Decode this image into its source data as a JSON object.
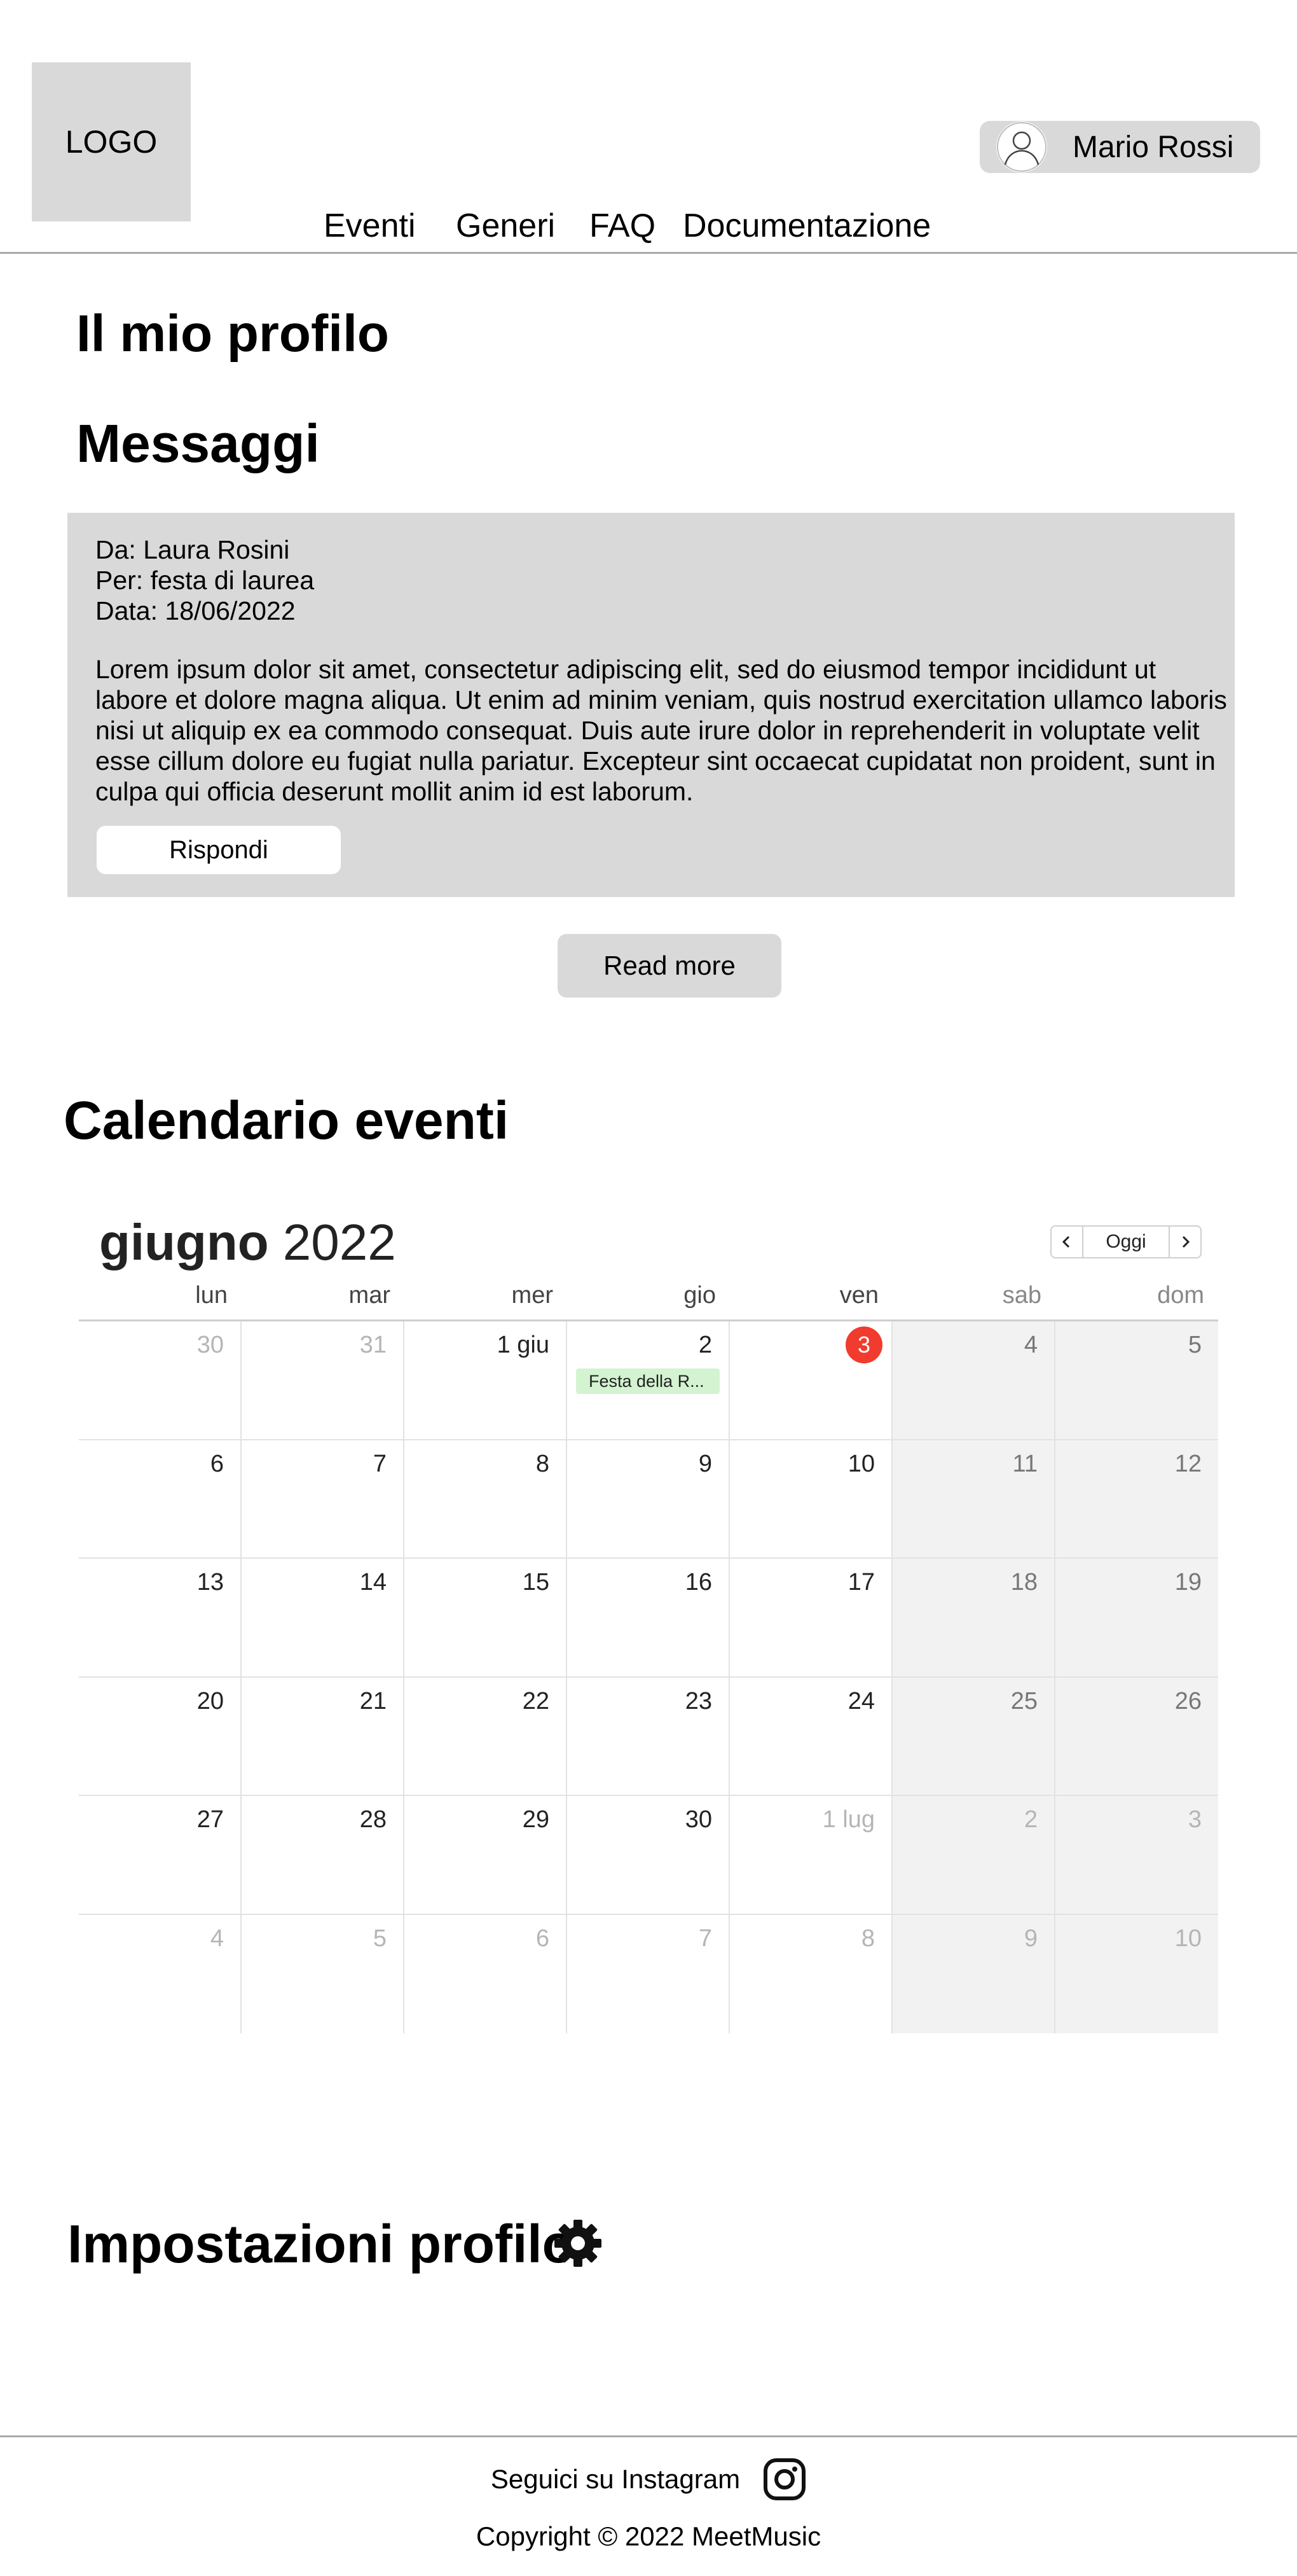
{
  "header": {
    "logo_text": "LOGO",
    "user_name": "Mario Rossi",
    "nav": [
      "Eventi",
      "Generi",
      "FAQ",
      "Documentazione"
    ]
  },
  "page_title": "Il mio profilo",
  "messages": {
    "title": "Messaggi",
    "from": "Da: Laura Rosini",
    "subject": "Per: festa di laurea",
    "date": "Data: 18/06/2022",
    "body": "Lorem ipsum dolor sit amet, consectetur adipiscing elit, sed do eiusmod tempor incididunt ut labore et dolore magna aliqua. Ut enim ad minim veniam, quis nostrud exercitation ullamco laboris nisi ut aliquip ex ea commodo consequat. Duis aute irure dolor in reprehenderit in voluptate velit esse cillum dolore eu fugiat nulla pariatur. Excepteur sint occaecat cupidatat non proident, sunt in culpa qui officia deserunt mollit anim id est laborum.",
    "reply_label": "Rispondi",
    "read_more_label": "Read more"
  },
  "calendar": {
    "title": "Calendario eventi",
    "month_name": "giugno",
    "year": "2022",
    "today_label": "Oggi",
    "weekdays": [
      "lun",
      "mar",
      "mer",
      "gio",
      "ven",
      "sab",
      "dom"
    ],
    "weeks": [
      [
        "30",
        "31",
        "1 giu",
        "2",
        "3",
        "4",
        "5"
      ],
      [
        "6",
        "7",
        "8",
        "9",
        "10",
        "11",
        "12"
      ],
      [
        "13",
        "14",
        "15",
        "16",
        "17",
        "18",
        "19"
      ],
      [
        "20",
        "21",
        "22",
        "23",
        "24",
        "25",
        "26"
      ],
      [
        "27",
        "28",
        "29",
        "30",
        "1 lug",
        "2",
        "3"
      ],
      [
        "4",
        "5",
        "6",
        "7",
        "8",
        "9",
        "10"
      ]
    ],
    "other_month": [
      [
        true,
        true,
        false,
        false,
        false,
        false,
        false
      ],
      [
        false,
        false,
        false,
        false,
        false,
        false,
        false
      ],
      [
        false,
        false,
        false,
        false,
        false,
        false,
        false
      ],
      [
        false,
        false,
        false,
        false,
        false,
        false,
        false
      ],
      [
        false,
        false,
        false,
        false,
        true,
        true,
        true
      ],
      [
        true,
        true,
        true,
        true,
        true,
        true,
        true
      ]
    ],
    "today": "3",
    "event": {
      "date": "2",
      "label": "Festa della R..."
    },
    "colors": {
      "today": "#f03b2e",
      "event_bg": "#d4f3d1",
      "weekend_bg": "#f2f2f2"
    }
  },
  "settings": {
    "title": "Impostazioni profilo",
    "icon": "gear-icon"
  },
  "footer": {
    "instagram_label": "Seguici su Instagram",
    "instagram_icon": "instagram-icon",
    "copyright": "Copyright © 2022 MeetMusic"
  }
}
